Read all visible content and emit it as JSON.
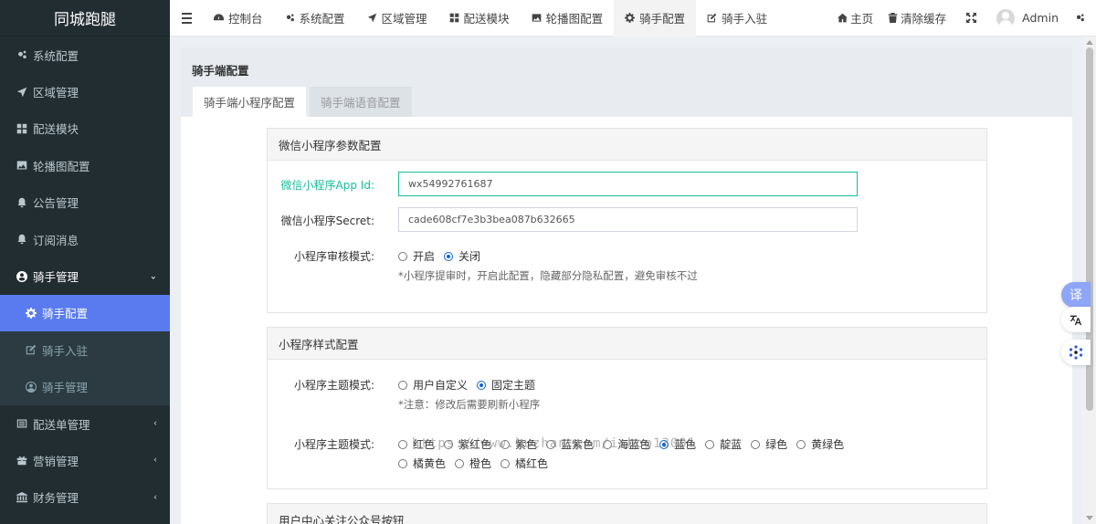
{
  "brand": "同城跑腿",
  "sidebar": {
    "items": [
      {
        "label": "系统配置"
      },
      {
        "label": "区域管理"
      },
      {
        "label": "配送模块"
      },
      {
        "label": "轮播图配置"
      },
      {
        "label": "公告管理"
      },
      {
        "label": "订阅消息"
      },
      {
        "label": "骑手管理"
      },
      {
        "label": "配送单管理"
      },
      {
        "label": "营销管理"
      },
      {
        "label": "财务管理"
      }
    ],
    "sub_items": [
      {
        "label": "骑手配置"
      },
      {
        "label": "骑手入驻"
      },
      {
        "label": "骑手管理"
      }
    ]
  },
  "topbar": {
    "tabs": [
      {
        "label": "控制台"
      },
      {
        "label": "系统配置"
      },
      {
        "label": "区域管理"
      },
      {
        "label": "配送模块"
      },
      {
        "label": "轮播图配置"
      },
      {
        "label": "骑手配置"
      },
      {
        "label": "骑手入驻"
      }
    ],
    "home": "主页",
    "clear_cache": "清除缓存",
    "user": "Admin"
  },
  "page": {
    "title": "骑手端配置",
    "tabs": [
      {
        "label": "骑手端小程序配置"
      },
      {
        "label": "骑手端语音配置"
      }
    ]
  },
  "wechat_panel": {
    "title": "微信小程序参数配置",
    "app_id_label": "微信小程序App Id:",
    "app_id_value": "wx54992761687",
    "secret_label": "微信小程序Secret:",
    "secret_value": "cade608cf7e3b3bea087b632665",
    "review_label": "小程序审核模式:",
    "review_options": [
      "开启",
      "关闭"
    ],
    "review_selected": "关闭",
    "review_hint": "*小程序提审时，开启此配置，隐藏部分隐私配置，避免审核不过"
  },
  "style_panel": {
    "title": "小程序样式配置",
    "theme_mode_label": "小程序主题模式:",
    "theme_mode_options": [
      "用户自定义",
      "固定主题"
    ],
    "theme_mode_selected": "固定主题",
    "theme_mode_hint": "*注意：修改后需要刷新小程序",
    "theme_color_label": "小程序主题模式:",
    "theme_color_options": [
      "红色",
      "紫红色",
      "紫色",
      "蓝紫色",
      "海蓝色",
      "蓝色",
      "靛蓝",
      "绿色",
      "黄绿色",
      "橘黄色",
      "橙色",
      "橘红色"
    ],
    "theme_color_selected": "蓝色"
  },
  "user_panel": {
    "title": "用户中心关注公众号按钮"
  },
  "watermark": "https://www.huzhan.com/ishop13001",
  "float": {
    "translate_label": "译"
  },
  "colors": {
    "sidebar_bg": "#222d32",
    "active_sub": "#5a7bef",
    "focus": "#18bc9c"
  }
}
